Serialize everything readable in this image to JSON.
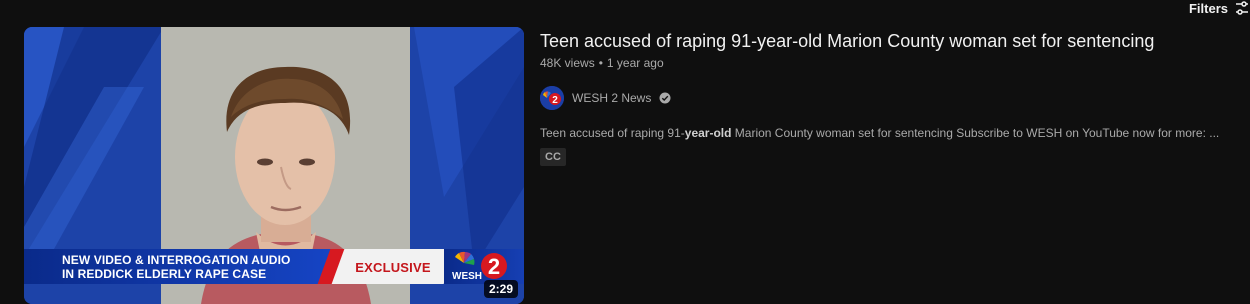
{
  "toolbar": {
    "filters_label": "Filters",
    "filters_icon": "sliders-icon"
  },
  "video": {
    "title": "Teen accused of raping 91-year-old Marion County woman set for sentencing",
    "views": "48K views",
    "separator": "•",
    "age": "1 year ago",
    "duration": "2:29",
    "thumbnail": {
      "banner_line1": "NEW VIDEO & INTERROGATION AUDIO",
      "banner_line2": "IN REDDICK ELDERLY RAPE CASE",
      "tag": "EXCLUSIVE",
      "logo_text": "WESH",
      "logo_number": "2"
    },
    "channel": {
      "name": "WESH 2 News",
      "verified_icon": "verified-check-icon"
    },
    "description": {
      "before": "Teen accused of raping 91-",
      "highlight": "year-old",
      "after": " Marion County woman set for sentencing Subscribe to WESH on YouTube now for more: ..."
    },
    "badge": "CC"
  },
  "colors": {
    "background": "#0f0f0f",
    "accent_red": "#d71920",
    "banner_blue": "#1645c6"
  }
}
